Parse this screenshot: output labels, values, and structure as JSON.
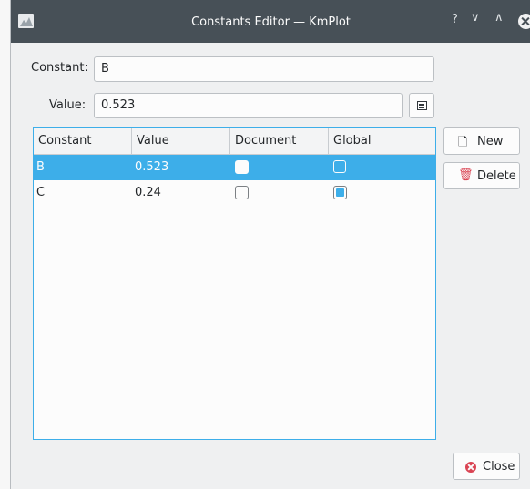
{
  "window": {
    "title": "Constants Editor — KmPlot",
    "controls": {
      "help": "?",
      "minimize": "∨",
      "maximize": "∧"
    }
  },
  "form": {
    "constant_label": "Constant:",
    "constant_value": "B",
    "value_label": "Value:",
    "value_value": "0.523"
  },
  "table": {
    "columns": [
      "Constant",
      "Value",
      "Document",
      "Global"
    ],
    "rows": [
      {
        "constant": "B",
        "value": "0.523",
        "document": false,
        "global": false,
        "selected": true
      },
      {
        "constant": "C",
        "value": "0.24",
        "document": false,
        "global": true,
        "selected": false
      }
    ]
  },
  "buttons": {
    "new_label": "New",
    "delete_label": "Delete",
    "close_label": "Close"
  },
  "colors": {
    "titlebar": "#475057",
    "selection": "#3daee9",
    "window_bg": "#eff0f1",
    "danger": "#da4453"
  }
}
